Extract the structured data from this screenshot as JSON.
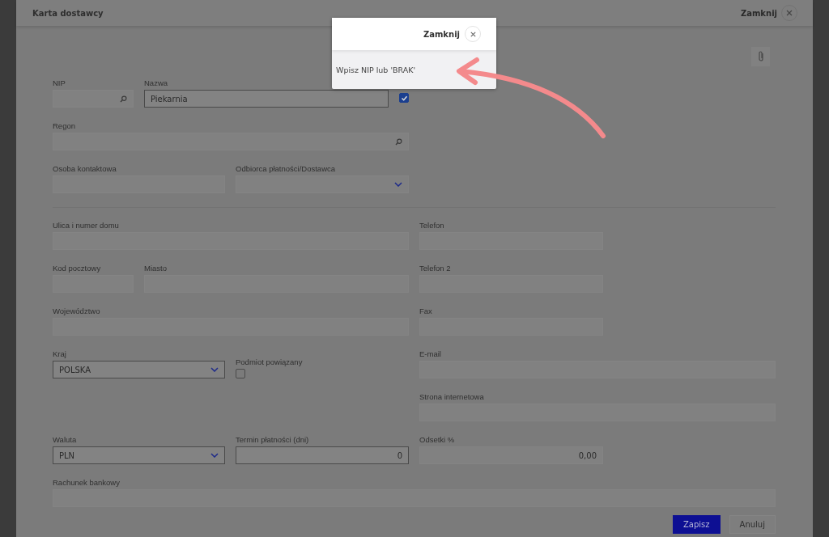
{
  "window": {
    "title": "Karta dostawcy",
    "close_label": "Zamknij"
  },
  "popup": {
    "close_label": "Zamknij",
    "message": "Wpisz NIP lub 'BRAK'"
  },
  "fields": [
    {
      "kind": "search",
      "label": "NIP",
      "highlighted": false
    },
    {
      "kind": "text",
      "label": "Nazwa",
      "value": "Piekarnia",
      "highlighted": true
    },
    {
      "kind": "checkbox",
      "checked": true
    },
    {
      "kind": "search",
      "label": "Regon",
      "highlighted": false
    },
    {
      "kind": "text",
      "label": "Osoba kontaktowa",
      "highlighted": false
    },
    {
      "kind": "select",
      "label": "Odbiorca płatności/Dostawca",
      "highlighted": false
    },
    {
      "kind": "text",
      "label": "Ulica i numer domu",
      "highlighted": false
    },
    {
      "kind": "text",
      "label": "Telefon",
      "highlighted": false
    },
    {
      "kind": "text",
      "label": "Kod pocztowy",
      "highlighted": false
    },
    {
      "kind": "text",
      "label": "Miasto",
      "highlighted": false
    },
    {
      "kind": "text",
      "label": "Telefon 2",
      "highlighted": false
    },
    {
      "kind": "text",
      "label": "Województwo",
      "highlighted": false
    },
    {
      "kind": "text",
      "label": "Fax",
      "highlighted": false
    },
    {
      "kind": "select",
      "label": "Kraj",
      "value": "POLSKA",
      "highlighted": true
    },
    {
      "kind": "checkbox",
      "label": "Podmiot powiązany",
      "checked": false
    },
    {
      "kind": "text",
      "label": "E-mail",
      "highlighted": false
    },
    {
      "kind": "text",
      "label": "Strona internetowa",
      "highlighted": false
    },
    {
      "kind": "select",
      "label": "Waluta",
      "value": "PLN",
      "highlighted": true
    },
    {
      "kind": "number",
      "label": "Termin płatności (dni)",
      "value": "0",
      "highlighted": true
    },
    {
      "kind": "number",
      "label": "Odsetki %",
      "value": "0,00",
      "highlighted": false
    },
    {
      "kind": "text",
      "label": "Rachunek bankowy",
      "highlighted": false
    }
  ],
  "buttons": [
    {
      "label": "Zapisz",
      "kind": "primary"
    },
    {
      "label": "Anuluj",
      "kind": "secondary"
    }
  ]
}
